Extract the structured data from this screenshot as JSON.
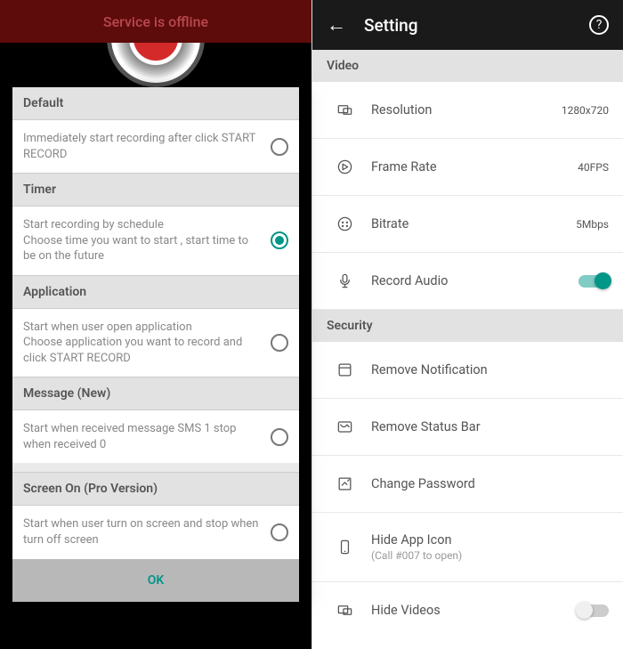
{
  "left": {
    "banner": "Service is offline",
    "dialog": {
      "sections": [
        {
          "header": "Default",
          "text": "Immediately start recording after click START RECORD",
          "selected": false
        },
        {
          "header": "Timer",
          "text": "Start recording by schedule\nChoose time you want to start , start time to be on the future",
          "selected": true
        },
        {
          "header": "Application",
          "text": "Start when user open application\nChoose application you want to record and click START RECORD",
          "selected": false
        },
        {
          "header": "Message (New)",
          "text": "Start when received message SMS 1 stop when received 0",
          "selected": false
        },
        {
          "header": "Screen On (Pro Version)",
          "text": "Start when user turn on screen and stop when turn off screen",
          "selected": false
        }
      ],
      "ok": "OK"
    }
  },
  "right": {
    "title": "Setting",
    "groups": [
      {
        "header": "Video",
        "items": [
          {
            "icon": "resolution",
            "label": "Resolution",
            "value": "1280x720"
          },
          {
            "icon": "framerate",
            "label": "Frame Rate",
            "value": "40FPS"
          },
          {
            "icon": "bitrate",
            "label": "Bitrate",
            "value": "5Mbps"
          },
          {
            "icon": "mic",
            "label": "Record Audio",
            "toggle": true
          }
        ]
      },
      {
        "header": "Security",
        "items": [
          {
            "icon": "notification",
            "label": "Remove Notification"
          },
          {
            "icon": "statusbar",
            "label": "Remove Status Bar"
          },
          {
            "icon": "password",
            "label": "Change Password"
          },
          {
            "icon": "hideapp",
            "label": "Hide App Icon",
            "sublabel": "(Call #007 to open)"
          },
          {
            "icon": "hidevideo",
            "label": "Hide Videos",
            "toggle": false
          }
        ]
      }
    ]
  }
}
